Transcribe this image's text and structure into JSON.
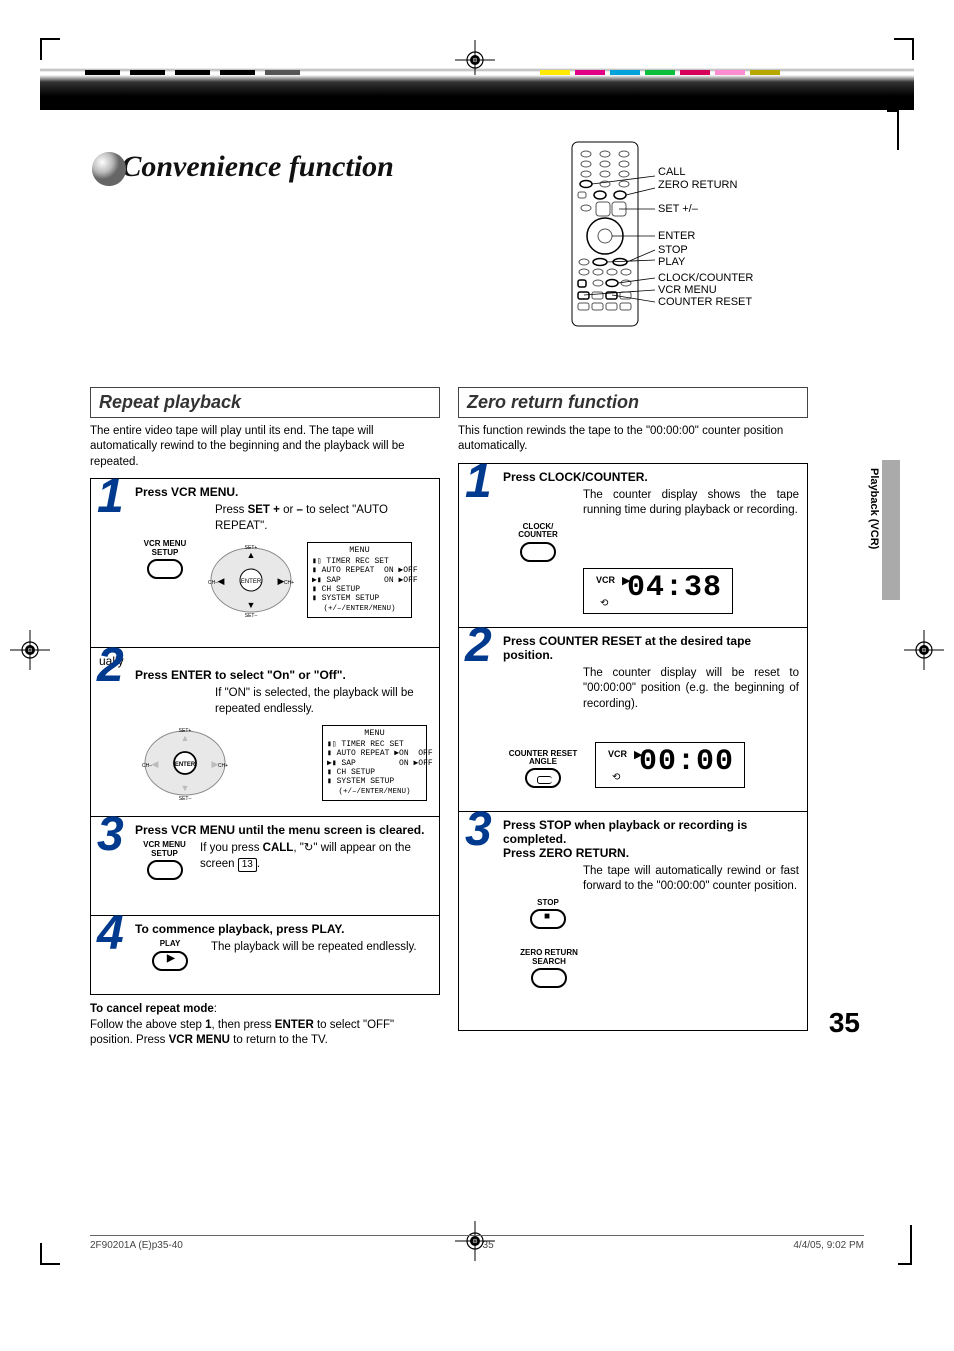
{
  "title": "Convenience function",
  "remote": {
    "labels": [
      "CALL",
      "ZERO RETURN",
      "SET +/–",
      "ENTER",
      "STOP",
      "PLAY",
      "CLOCK/COUNTER",
      "VCR MENU",
      "COUNTER RESET"
    ]
  },
  "side_tab": "Playback (VCR)",
  "page_number": "35",
  "footer": {
    "left": "2F90201A (E)p35-40",
    "mid": "35",
    "right": "4/4/05, 9:02 PM"
  },
  "left": {
    "heading": "Repeat playback",
    "intro": "The entire video tape will play until its end. The tape will automatically rewind to the beginning and the playback will be repeated.",
    "s1": {
      "title": "Press VCR MENU.",
      "sub_a": "Press ",
      "sub_b": "SET +",
      "sub_c": " or ",
      "sub_d": "–",
      "sub_e": " to select \"AUTO REPEAT\".",
      "btn_label": "VCR MENU\nSETUP",
      "osd": {
        "title": "MENU",
        "r1": "▮▯ TIMER REC SET",
        "r2": "▮ AUTO REPEAT  ON ▶OFF",
        "r3": "▶▮ SAP         ON ▶OFF",
        "r4": "▮ CH SETUP",
        "r5": "▮ SYSTEM SETUP",
        "footer": "(+/–/ENTER/MENU)"
      }
    },
    "s2": {
      "title": "Press ENTER to select \"On\" or \"Off\".",
      "sub": "If \"ON\" is selected, the playback will be repeated endlessly.",
      "osd": {
        "title": "MENU",
        "r1": "▮▯ TIMER REC SET",
        "r2": "▮ AUTO REPEAT ▶ON  OFF",
        "r3": "▶▮ SAP         ON ▶OFF",
        "r4": "▮ CH SETUP",
        "r5": "▮ SYSTEM SETUP",
        "footer": "(+/–/ENTER/MENU)"
      }
    },
    "s3": {
      "title": "Press VCR MENU until the menu screen is cleared.",
      "sub_a": "If you press ",
      "sub_b": "CALL",
      "sub_c": ", \"↻\" will appear on the screen ",
      "pageref": "13",
      "sub_d": ".",
      "btn_label": "VCR MENU\nSETUP"
    },
    "s4": {
      "title": "To commence playback, press PLAY.",
      "sub": "The playback will be repeated endlessly.",
      "btn_label": "PLAY"
    },
    "cancel": {
      "lead": "To cancel repeat mode",
      "body_a": "Follow the above step ",
      "body_b": "1",
      "body_c": ", then press ",
      "body_d": "ENTER",
      "body_e": " to select \"OFF\" position. Press ",
      "body_f": "VCR MENU",
      "body_g": " to return to the TV."
    }
  },
  "right": {
    "heading": "Zero return function",
    "intro": "This function rewinds the tape to the \"00:00:00\" counter position automatically.",
    "s1": {
      "title": "Press CLOCK/COUNTER.",
      "sub": "The counter display shows the tape running time during playback or recording.",
      "btn_label": "CLOCK/\nCOUNTER",
      "lcd": {
        "vcr": "VCR",
        "digits": "04:38"
      }
    },
    "s2": {
      "title": "Press COUNTER RESET at the desired tape position.",
      "sub": "The counter display will be reset to \"00:00:00\" position (e.g. the beginning of recording).",
      "btn_label": "COUNTER RESET\nANGLE",
      "lcd": {
        "vcr": "VCR",
        "digits": "00:00"
      }
    },
    "s3": {
      "title_a": "Press STOP when playback or recording is completed.",
      "title_b": "Press ZERO RETURN.",
      "sub": "The tape will automatically rewind or fast forward to the \"00:00:00\" counter position.",
      "btn1": "STOP",
      "btn2": "ZERO RETURN\nSEARCH"
    }
  }
}
